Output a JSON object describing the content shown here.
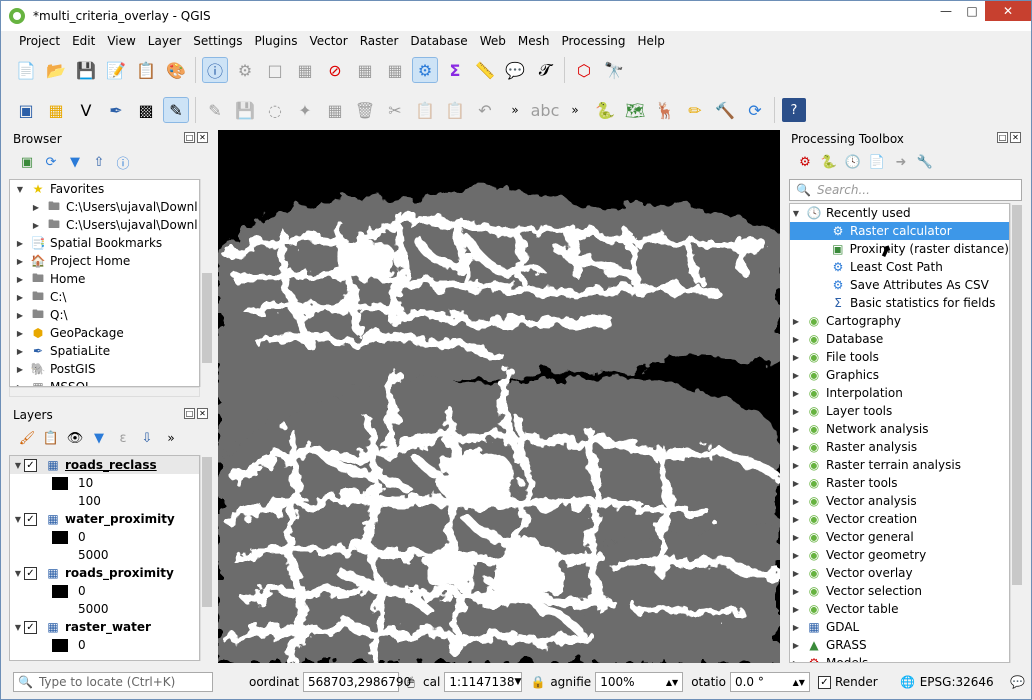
{
  "window": {
    "title": "*multi_criteria_overlay - QGIS"
  },
  "menu": [
    "Project",
    "Edit",
    "View",
    "Layer",
    "Settings",
    "Plugins",
    "Vector",
    "Raster",
    "Database",
    "Web",
    "Mesh",
    "Processing",
    "Help"
  ],
  "browser": {
    "title": "Browser",
    "items": [
      {
        "label": "Favorites",
        "level": 0,
        "icon": "star-icon"
      },
      {
        "label": "C:\\Users\\ujaval\\Downl",
        "level": 1,
        "icon": "folder-icon"
      },
      {
        "label": "C:\\Users\\ujaval\\Downl",
        "level": 1,
        "icon": "folder-icon"
      },
      {
        "label": "Spatial Bookmarks",
        "level": 0,
        "icon": "bookmark-icon"
      },
      {
        "label": "Project Home",
        "level": 0,
        "icon": "project-home-icon"
      },
      {
        "label": "Home",
        "level": 0,
        "icon": "home-folder-icon"
      },
      {
        "label": "C:\\",
        "level": 0,
        "icon": "drive-icon"
      },
      {
        "label": "Q:\\",
        "level": 0,
        "icon": "drive-icon"
      },
      {
        "label": "GeoPackage",
        "level": 0,
        "icon": "geopackage-icon"
      },
      {
        "label": "SpatiaLite",
        "level": 0,
        "icon": "spatialite-icon"
      },
      {
        "label": "PostGIS",
        "level": 0,
        "icon": "postgis-icon"
      },
      {
        "label": "MSSQL",
        "level": 0,
        "icon": "mssql-icon"
      }
    ]
  },
  "layers": {
    "title": "Layers",
    "items": [
      {
        "name": "roads_reclass",
        "bold": true,
        "legend": [
          "10",
          "100"
        ]
      },
      {
        "name": "water_proximity",
        "bold": false,
        "legend": [
          "0",
          "5000"
        ]
      },
      {
        "name": "roads_proximity",
        "bold": false,
        "legend": [
          "0",
          "5000"
        ]
      },
      {
        "name": "raster_water",
        "bold": false,
        "legend": [
          "0"
        ]
      }
    ]
  },
  "toolbox": {
    "title": "Processing Toolbox",
    "search_placeholder": "Search...",
    "recent_label": "Recently used",
    "recent": [
      "Raster calculator",
      "Proximity (raster distance)",
      "Least Cost Path",
      "Save Attributes As CSV",
      "Basic statistics for fields"
    ],
    "groups": [
      "Cartography",
      "Database",
      "File tools",
      "Graphics",
      "Interpolation",
      "Layer tools",
      "Network analysis",
      "Raster analysis",
      "Raster terrain analysis",
      "Raster tools",
      "Vector analysis",
      "Vector creation",
      "Vector general",
      "Vector geometry",
      "Vector overlay",
      "Vector selection",
      "Vector table"
    ],
    "providers": [
      "GDAL",
      "GRASS",
      "Models"
    ]
  },
  "status": {
    "locate_placeholder": "Type to locate (Ctrl+K)",
    "coord_label": "oordinat",
    "coord_value": "568703,2986790",
    "scale_label": "cal",
    "scale_value": "1:1147138",
    "magnifier_label": "agnifie",
    "magnifier_value": "100%",
    "rotation_label": "otatio",
    "rotation_value": "0.0 °",
    "render_label": "Render",
    "crs": "EPSG:32646"
  }
}
